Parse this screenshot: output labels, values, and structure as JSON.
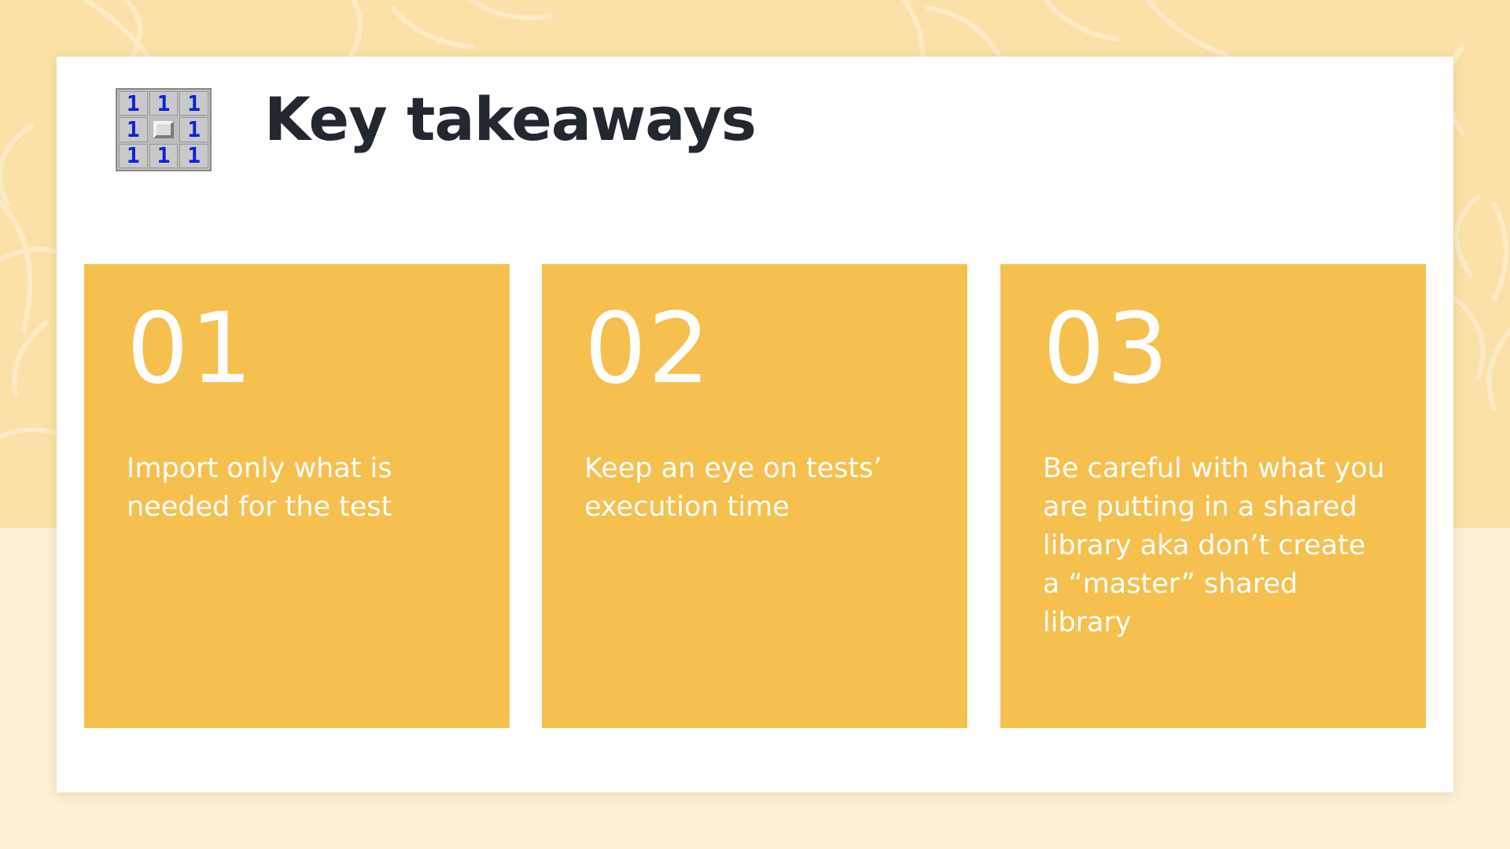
{
  "slide": {
    "title": "Key takeaways",
    "logo": {
      "icon": "minesweeper-grid-icon",
      "cells": [
        "1",
        "1",
        "1",
        "1",
        "",
        "1",
        "1",
        "1",
        "1"
      ]
    },
    "takeaways": [
      {
        "number": "01",
        "text": "Import only what is needed for the test"
      },
      {
        "number": "02",
        "text": "Keep an eye on tests’ execution time"
      },
      {
        "number": "03",
        "text": "Be careful with what you are putting in a shared library aka don’t create a “master” shared library"
      }
    ]
  },
  "colors": {
    "background_top": "#fbe1a8",
    "background_bottom": "#fdf0d6",
    "card": "#ffffff",
    "accent": "#f6c04f",
    "title": "#232730",
    "logo_digit": "#0b1fe0"
  }
}
